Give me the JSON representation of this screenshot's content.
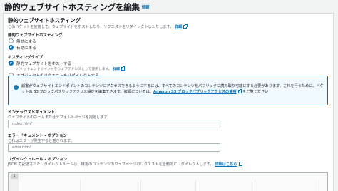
{
  "page": {
    "title": "静的ウェブサイトホスティングを編集",
    "info": "情報"
  },
  "section": {
    "title": "静的ウェブサイトホスティング",
    "description": "このバケットを使用して、ウェブサイトをホストしたり、リクエストをリダイレクトしたりします。",
    "learn_more": "詳細"
  },
  "hosting_toggle": {
    "label": "静的ウェブサイトホスティング",
    "options": [
      {
        "label": "無効にする",
        "selected": false
      },
      {
        "label": "有効にする",
        "selected": true
      }
    ]
  },
  "hosting_type": {
    "label": "ホスティングタイプ",
    "options": [
      {
        "label": "静的ウェブサイトをホストする",
        "description": "バケットエンドポイントをウェブアドレスとして使用します。",
        "link": "詳細",
        "selected": true
      },
      {
        "label": "オブジェクトのリクエストをリダイレクトする",
        "description": "リクエストを別のバケットまたはドメインにリダイレクトします。",
        "link": "詳細",
        "selected": false
      }
    ]
  },
  "notice": {
    "text_1": "顧客がウェブサイトエンドポイントのコンテンツにアクセスできるようにするには、すべてのコンテンツをパブリックに読み取り可能にする必要があります。これを行うために、バケットの S3 ブロックパブリックアクセス設定を編集できます。詳細については、",
    "link": "Amazon S3 ブロックパブリックアクセスの使用",
    "text_2": "をご覧ください"
  },
  "index_document": {
    "label": "インデックスドキュメント",
    "description": "ウェブサイトのホームまたはデフォルトページを指定します。",
    "placeholder": "index.html"
  },
  "error_document": {
    "label": "エラードキュメント - オプション",
    "description": "これはエラーが発生すると返されます。",
    "placeholder": "error.html"
  },
  "redirect_rules": {
    "label": "リダイレクトルール - オプション",
    "description": "JSON で記述されたリダイレクトルールは、特定のコンテンツのウェブページのリクエストを自動的にリダイレクトします。",
    "link": "詳細はこちら",
    "line_number": "1"
  }
}
